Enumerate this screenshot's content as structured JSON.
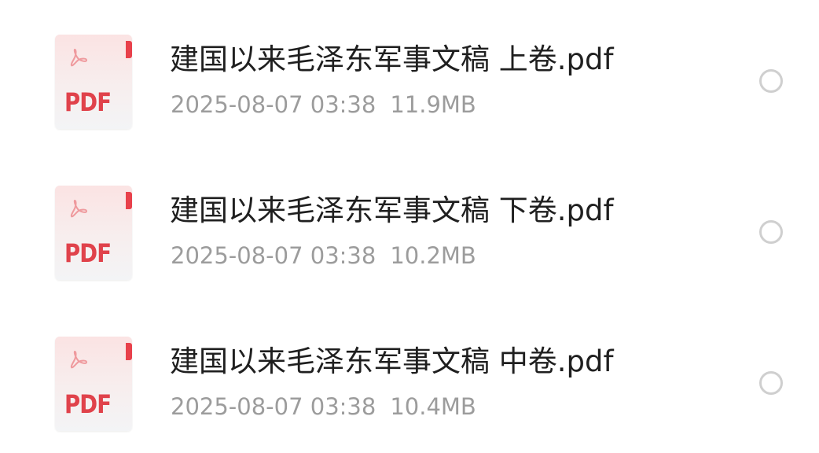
{
  "files": [
    {
      "name": "建国以来毛泽东军事文稿 上卷.pdf",
      "date": "2025-08-07 03:38",
      "size": "11.9MB",
      "icon": {
        "name": "pdf-file-icon",
        "label": "PDF"
      },
      "selected": false
    },
    {
      "name": "建国以来毛泽东军事文稿 下卷.pdf",
      "date": "2025-08-07 03:38",
      "size": "10.2MB",
      "icon": {
        "name": "pdf-file-icon",
        "label": "PDF"
      },
      "selected": false
    },
    {
      "name": "建国以来毛泽东军事文稿 中卷.pdf",
      "date": "2025-08-07 03:38",
      "size": "10.4MB",
      "icon": {
        "name": "pdf-file-icon",
        "label": "PDF"
      },
      "selected": false
    }
  ],
  "colors": {
    "pdf_red": "#e0424b",
    "title_text": "#1f1f1f",
    "meta_text": "#9c9c9c",
    "radio_border": "#cfcfcf"
  }
}
